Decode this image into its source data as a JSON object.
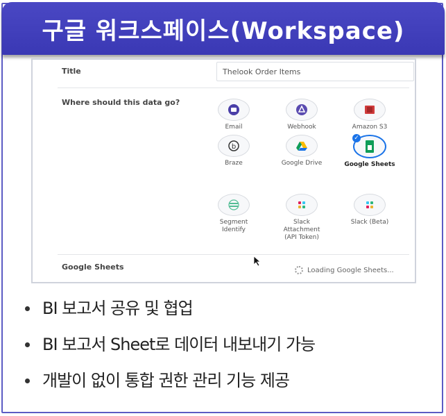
{
  "banner": {
    "title": "구글 워크스페이스(Workspace)"
  },
  "form": {
    "title_label": "Title",
    "title_value": "Thelook Order Items",
    "destination_label": "Where should this data go?",
    "destinations": [
      {
        "label": "Email",
        "icon": "email-icon",
        "color": "#4a3fa8",
        "selected": false
      },
      {
        "label": "Webhook",
        "icon": "webhook-icon",
        "color": "#5a4bb0",
        "selected": false
      },
      {
        "label": "Amazon S3",
        "icon": "amazon-s3-icon",
        "color": "#d13c3c",
        "selected": false
      },
      {
        "label": "Braze",
        "icon": "braze-icon",
        "color": "#333333",
        "selected": false
      },
      {
        "label": "Google Drive",
        "icon": "google-drive-icon",
        "color": "#1a73e8",
        "selected": false
      },
      {
        "label": "Google Sheets",
        "icon": "google-sheets-icon",
        "color": "#0f9d58",
        "selected": true
      },
      {
        "label": "Segment Identify",
        "icon": "segment-icon",
        "color": "#52bd94",
        "selected": false
      },
      {
        "label": "Slack Attachment (API Token)",
        "icon": "slack-icon",
        "color": "#e01e5a",
        "selected": false
      },
      {
        "label": "Slack (Beta)",
        "icon": "slack-icon",
        "color": "#36c5f0",
        "selected": false
      }
    ],
    "section_label": "Google Sheets",
    "loading_text": "Loading Google Sheets..."
  },
  "bullets": [
    "BI 보고서 공유 및 협업",
    "BI 보고서 Sheet로 데이터 내보내기 가능",
    "개발이 없이 통합 권한 관리 기능 제공"
  ]
}
